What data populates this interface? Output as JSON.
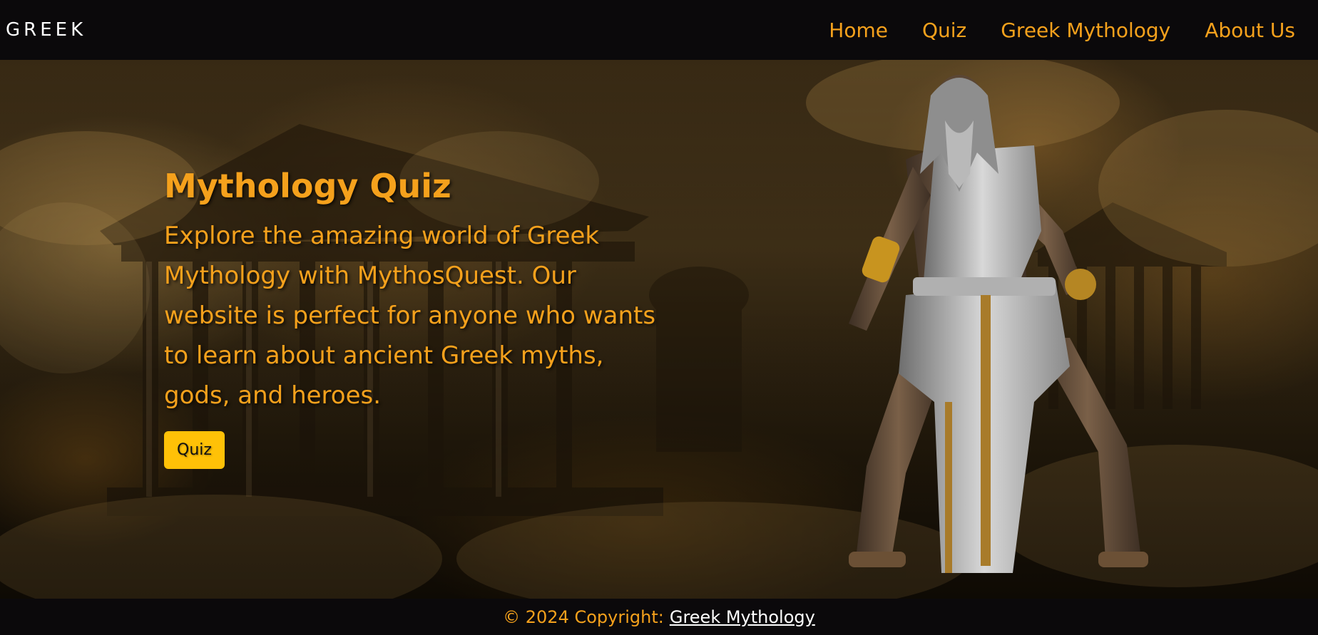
{
  "navbar": {
    "brand": "GREEK",
    "links": [
      {
        "label": "Home"
      },
      {
        "label": "Quiz"
      },
      {
        "label": "Greek Mythology"
      },
      {
        "label": "About Us"
      }
    ]
  },
  "hero": {
    "title": "Mythology Quiz",
    "description": "Explore the amazing world of Greek Mythology with MythosQuest. Our website is perfect for anyone who wants to learn about ancient Greek myths, gods, and heroes.",
    "button_label": "Quiz"
  },
  "footer": {
    "prefix": "© 2024 Copyright:",
    "link_label": "Greek Mythology"
  },
  "colors": {
    "accent": "#f5a11c",
    "button": "#ffc107",
    "bar_background": "#0b090b"
  }
}
